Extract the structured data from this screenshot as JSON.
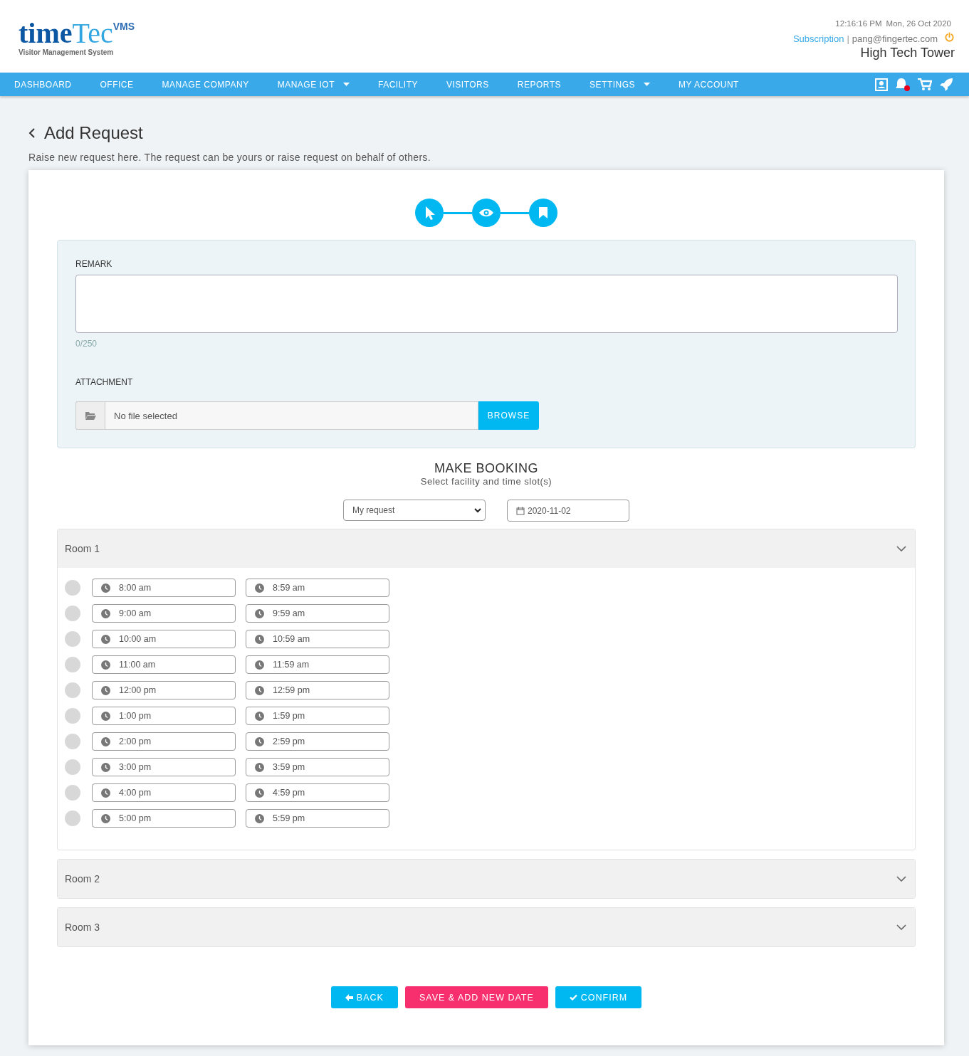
{
  "logo": {
    "word_1": "time",
    "word_2": "Tec",
    "badge": "VMS",
    "tagline": "Visitor Management System"
  },
  "header": {
    "time": "12:16:16 PM",
    "date": "Mon, 26 Oct 2020",
    "subscription_link": "Subscription",
    "separator": "|",
    "email": "pang@fingertec.com",
    "building": "High Tech Tower"
  },
  "nav": [
    {
      "label": "DASHBOARD",
      "dropdown": false
    },
    {
      "label": "OFFICE",
      "dropdown": false
    },
    {
      "label": "MANAGE COMPANY",
      "dropdown": false
    },
    {
      "label": "MANAGE IOT",
      "dropdown": true
    },
    {
      "label": "FACILITY",
      "dropdown": false
    },
    {
      "label": "VISITORS",
      "dropdown": false
    },
    {
      "label": "REPORTS",
      "dropdown": false
    },
    {
      "label": "SETTINGS",
      "dropdown": true
    },
    {
      "label": "MY ACCOUNT",
      "dropdown": false
    }
  ],
  "notifications": {
    "unread": true
  },
  "page": {
    "title": "Add Request",
    "subtitle": "Raise new request here. The request can be yours or raise request on behalf of others."
  },
  "steps": [
    {
      "kind": "pointer"
    },
    {
      "kind": "eye"
    },
    {
      "kind": "bookmark"
    }
  ],
  "remark": {
    "label": "REMARK",
    "counter": "0/250"
  },
  "attachment": {
    "label": "ATTACHMENT",
    "placeholder": "No file selected",
    "button": "BROWSE"
  },
  "booking": {
    "title": "MAKE BOOKING",
    "subtitle": "Select facility and time slot(s)",
    "request_select": "My request",
    "date": "2020-11-02"
  },
  "rooms": [
    {
      "name": "Room 1",
      "expanded": true,
      "slots": [
        {
          "start": "8:00 am",
          "end": "8:59 am",
          "selected": false
        },
        {
          "start": "9:00 am",
          "end": "9:59 am",
          "selected": false
        },
        {
          "start": "10:00 am",
          "end": "10:59 am",
          "selected": false
        },
        {
          "start": "11:00 am",
          "end": "11:59 am",
          "selected": false
        },
        {
          "start": "12:00 pm",
          "end": "12:59 pm",
          "selected": false
        },
        {
          "start": "1:00 pm",
          "end": "1:59 pm",
          "selected": false
        },
        {
          "start": "2:00 pm",
          "end": "2:59 pm",
          "selected": false
        },
        {
          "start": "3:00 pm",
          "end": "3:59 pm",
          "selected": false
        },
        {
          "start": "4:00 pm",
          "end": "4:59 pm",
          "selected": false
        },
        {
          "start": "5:00 pm",
          "end": "5:59 pm",
          "selected": false
        }
      ]
    },
    {
      "name": "Room 2",
      "expanded": false
    },
    {
      "name": "Room 3",
      "expanded": false
    }
  ],
  "buttons": [
    {
      "kind": "back",
      "label": "BACK"
    },
    {
      "kind": "save",
      "label": "SAVE & ADD NEW DATE"
    },
    {
      "kind": "confirm",
      "label": "CONFIRM"
    }
  ]
}
